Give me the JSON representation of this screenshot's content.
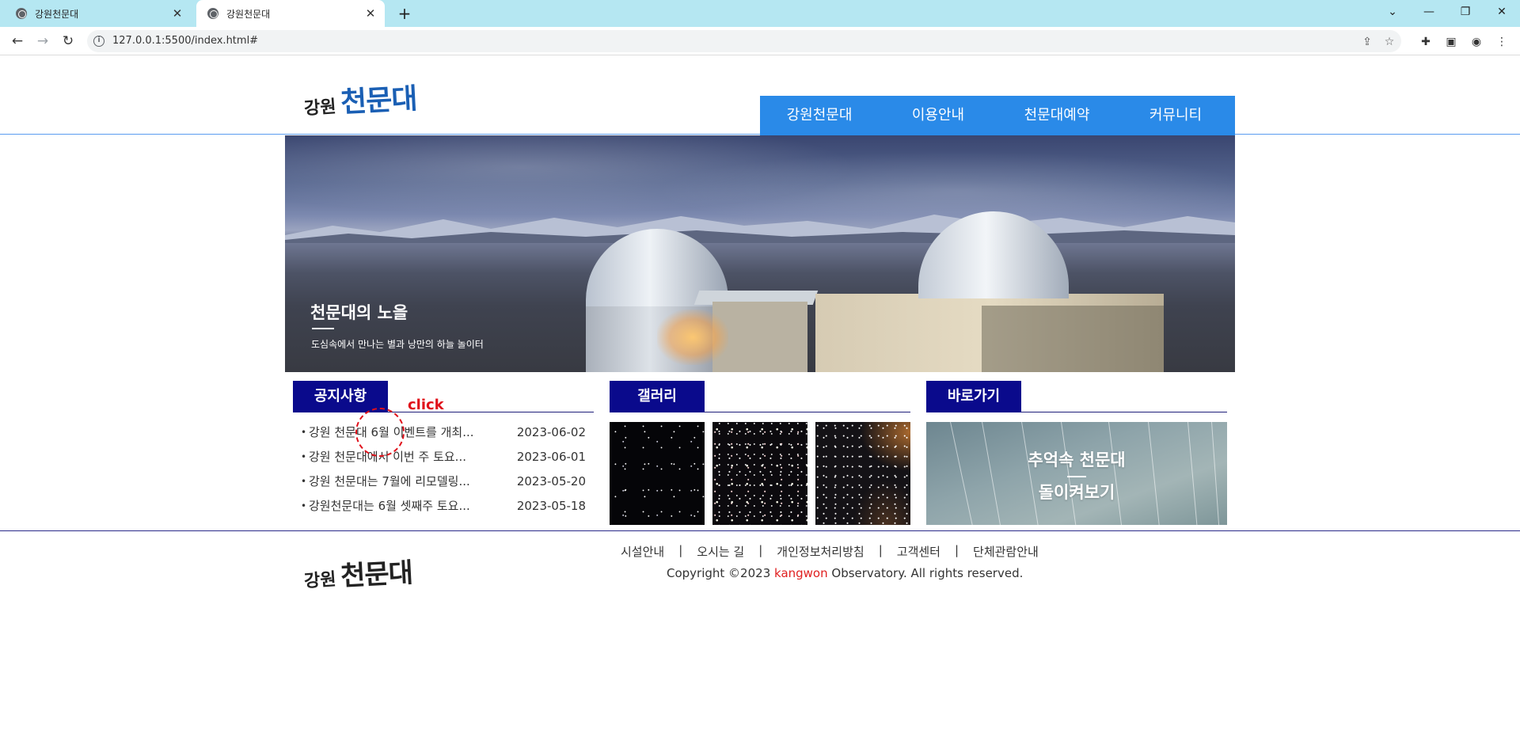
{
  "browser": {
    "tabs": [
      {
        "title": "강원천문대",
        "active": false
      },
      {
        "title": "강원천문대",
        "active": true
      }
    ],
    "new_tab_icon": "plus-icon",
    "url": "127.0.0.1:5500/index.html#",
    "window_controls": [
      "chevron-down-icon",
      "minimize-icon",
      "restore-icon",
      "close-icon"
    ]
  },
  "header": {
    "logo_small": "강원",
    "logo_big": "천문대",
    "nav": [
      "강원천문대",
      "이용안내",
      "천문대예약",
      "커뮤니티"
    ]
  },
  "hero": {
    "title": "천문대의 노을",
    "subtitle": "도심속에서 만나는 별과 낭만의 하늘 놀이터"
  },
  "notice": {
    "title": "공지사항",
    "items": [
      {
        "title": "강원 천문대 6월 이벤트를 개최...",
        "date": "2023-06-02"
      },
      {
        "title": "강원 천문대에서 이번 주 토요...",
        "date": "2023-06-01"
      },
      {
        "title": "강원 천문대는 7월에 리모델링...",
        "date": "2023-05-20"
      },
      {
        "title": "강원천문대는 6월 셋째주 토요...",
        "date": "2023-05-18"
      }
    ]
  },
  "annotation": {
    "click_label": "click"
  },
  "gallery": {
    "title": "갤러리"
  },
  "shortcut": {
    "title": "바로가기",
    "line1": "추억속 천문대",
    "line2": "돌이켜보기"
  },
  "footer": {
    "logo_small": "강원",
    "logo_big": "천문대",
    "links": [
      "시설안내",
      "오시는 길",
      "개인정보처리방침",
      "고객센터",
      "단체관람안내"
    ],
    "separator": "|",
    "copyright_prefix": "Copyright ©2023 ",
    "copyright_brand": "kangwon",
    "copyright_suffix": " Observatory. All rights reserved."
  },
  "colors": {
    "nav_bg": "#2a8ae8",
    "box_title_bg": "#0a0a8c",
    "brand_red": "#e02020",
    "logo_blue": "#1a5fb4"
  }
}
